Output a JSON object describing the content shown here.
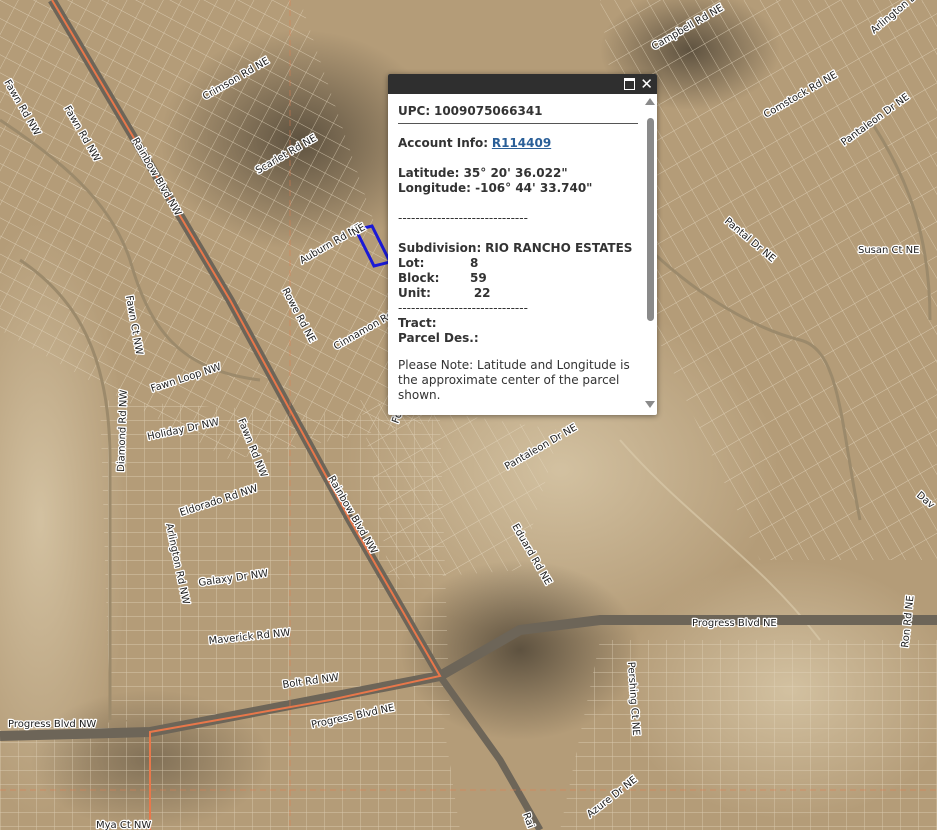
{
  "map": {
    "colors": {
      "ground": "#b49c78",
      "ground_light": "#c9b592",
      "dark_patch": "#5c5243",
      "parcel_line": "#e3d6bd",
      "main_road": "#e8774a",
      "parcel_highlight": "#1a19d6"
    },
    "road_labels": [
      {
        "id": "crimson-rd-ne",
        "text": "Crimson Rd NE"
      },
      {
        "id": "scarlet-rd-ne",
        "text": "Scarlet Rd NE"
      },
      {
        "id": "auburn-rd-ne",
        "text": "Auburn Rd NE"
      },
      {
        "id": "cinnamon-rd",
        "text": "Cinnamon Rd"
      },
      {
        "id": "rowe-rd-ne",
        "text": "Rowe Rd NE"
      },
      {
        "id": "rainbow-blvd-nw",
        "text": "Rainbow Blvd NW"
      },
      {
        "id": "rainbow-blvd-nw-2",
        "text": "Rainbow Blvd NW"
      },
      {
        "id": "rainbow-bottom",
        "text": "Rai"
      },
      {
        "id": "fawn-rd-nw-top",
        "text": "Fawn Rd NW"
      },
      {
        "id": "fawn-rd-nw-mid",
        "text": "Fawn Rd NW"
      },
      {
        "id": "fawn-rd-nw-left",
        "text": "Fawn Rd NW"
      },
      {
        "id": "fawn-ct-nw",
        "text": "Fawn Ct NW"
      },
      {
        "id": "fawn-loop-nw",
        "text": "Fawn Loop NW"
      },
      {
        "id": "holiday-dr-nw",
        "text": "Holiday Dr NW"
      },
      {
        "id": "diamond-rd-nw",
        "text": "Diamond Rd NW"
      },
      {
        "id": "eldorado-rd-nw",
        "text": "Eldorado Rd NW"
      },
      {
        "id": "arlington-rd-nw",
        "text": "Arlington Rd NW"
      },
      {
        "id": "galaxy-dr-nw",
        "text": "Galaxy Dr NW"
      },
      {
        "id": "maverick-rd-nw",
        "text": "Maverick Rd NW"
      },
      {
        "id": "bolt-rd-nw",
        "text": "Bolt Rd NW"
      },
      {
        "id": "progress-blvd-nw",
        "text": "Progress Blvd NW"
      },
      {
        "id": "progress-blvd-ne-left",
        "text": "Progress Blvd NE"
      },
      {
        "id": "progress-blvd-ne-right",
        "text": "Progress Blvd NE"
      },
      {
        "id": "mya-ct-nw",
        "text": "Mya Ct NW"
      },
      {
        "id": "campbell-rd-ne",
        "text": "Campbell Rd NE"
      },
      {
        "id": "comstock-rd-ne",
        "text": "Comstock Rd NE"
      },
      {
        "id": "arlington-dr-ne",
        "text": "Arlington Dr NE"
      },
      {
        "id": "pantaleon-dr-ne-top",
        "text": "Pantaleon Dr NE"
      },
      {
        "id": "pantaleon-dr-ne-mid",
        "text": "Pantaleon Dr NE"
      },
      {
        "id": "pantal-dr-ne",
        "text": "Pantal Dr NE"
      },
      {
        "id": "susan-ct-ne",
        "text": "Susan Ct NE"
      },
      {
        "id": "eduard-rd-ne",
        "text": "Eduard Rd NE"
      },
      {
        "id": "pershing-ct-ne",
        "text": "Pershing Ct NE"
      },
      {
        "id": "azure-dr-ne",
        "text": "Azure Dr NE"
      },
      {
        "id": "ron-rd-ne",
        "text": "Ron Rd NE"
      },
      {
        "id": "dav-edge",
        "text": "Dav"
      },
      {
        "id": "auburn-suffix",
        "text": "NE"
      },
      {
        "id": "cinnamon-suffix",
        "text": "Fo"
      }
    ]
  },
  "popup": {
    "upc_label": "UPC:",
    "upc_value": "1009075066341",
    "account_label": "Account Info:",
    "account_value": "R114409",
    "latitude": "Latitude: 35° 20' 36.022\"",
    "longitude": "Longitude: -106° 44' 33.740\"",
    "divider": "------------------------------",
    "subdivision_label": "Subdivision:",
    "subdivision_value": "RIO RANCHO ESTATES",
    "lot_label": "Lot:",
    "lot_value": "8",
    "block_label": "Block:",
    "block_value": "59",
    "unit_label": "Unit:",
    "unit_value": "22",
    "tract_label": "Tract:",
    "parcel_des_label": "Parcel Des.:",
    "note": "Please Note: Latitude and Longitude is the approximate center of the parcel shown."
  }
}
